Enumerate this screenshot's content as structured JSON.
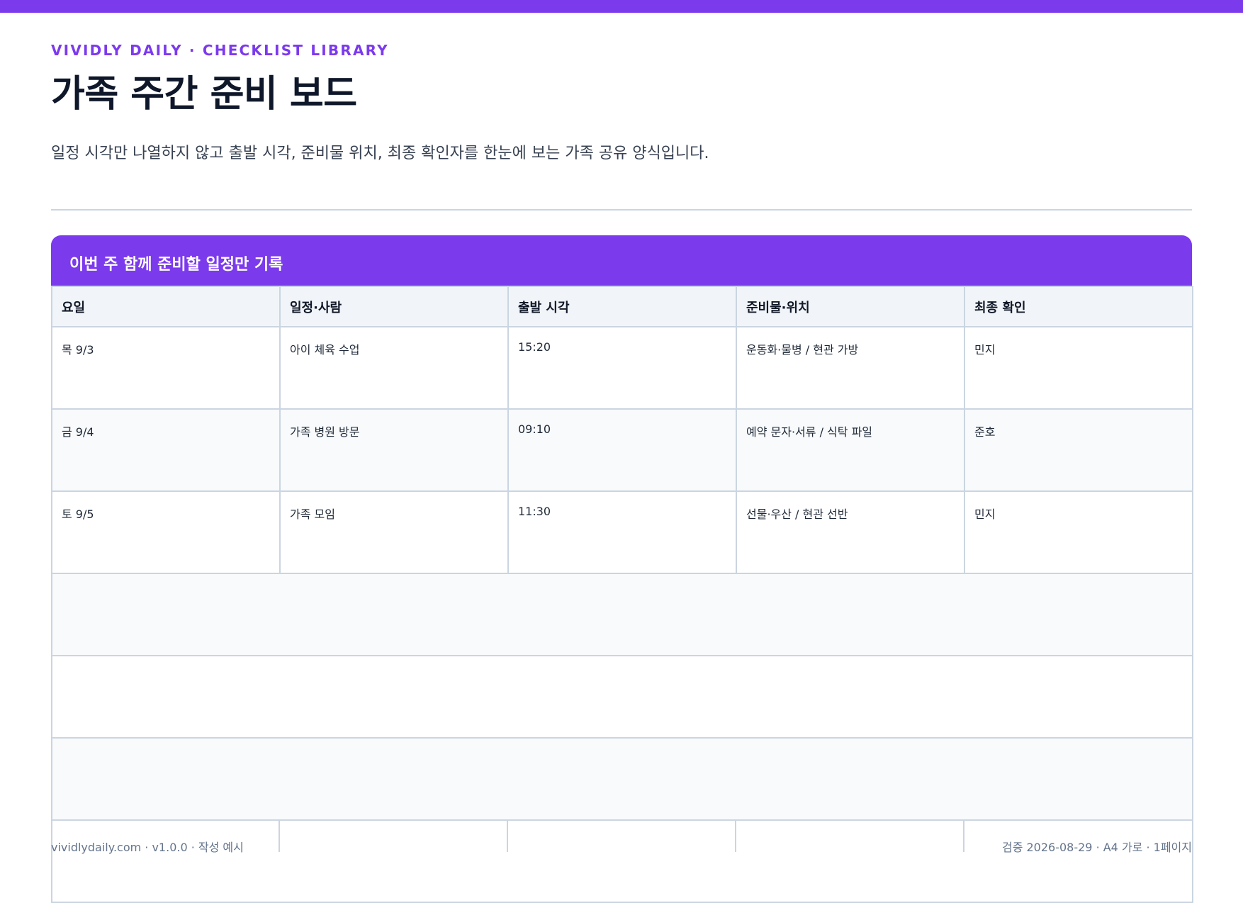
{
  "brand": {
    "accent": "#7c3aed"
  },
  "header": {
    "eyebrow": "VIVIDLY DAILY · CHECKLIST LIBRARY",
    "title": "가족 주간 준비 보드",
    "subtitle": "일정 시각만 나열하지 않고 출발 시각, 준비물 위치, 최종 확인자를 한눈에 보는 가족 공유 양식입니다."
  },
  "section": {
    "title": "이번 주 함께 준비할 일정만 기록",
    "columns": [
      "요일",
      "일정·사람",
      "출발 시각",
      "준비물·위치",
      "최종 확인"
    ],
    "rows": [
      [
        "목 9/3",
        "아이 체육 수업",
        "15:20",
        "운동화·물병 / 현관 가방",
        "민지"
      ],
      [
        "금 9/4",
        "가족 병원 방문",
        "09:10",
        "예약 문자·서류 / 식탁 파일",
        "준호"
      ],
      [
        "토 9/5",
        "가족 모임",
        "11:30",
        "선물·우산 / 현관 선반",
        "민지"
      ],
      [
        "",
        "",
        "",
        "",
        ""
      ],
      [
        "",
        "",
        "",
        "",
        ""
      ],
      [
        "",
        "",
        "",
        "",
        ""
      ],
      [
        "",
        "",
        "",
        "",
        ""
      ]
    ]
  },
  "footer": {
    "left": "vividlydaily.com · v1.0.0 · 작성 예시",
    "right": "검증 2026-08-29 · A4 가로 · 1페이지"
  }
}
